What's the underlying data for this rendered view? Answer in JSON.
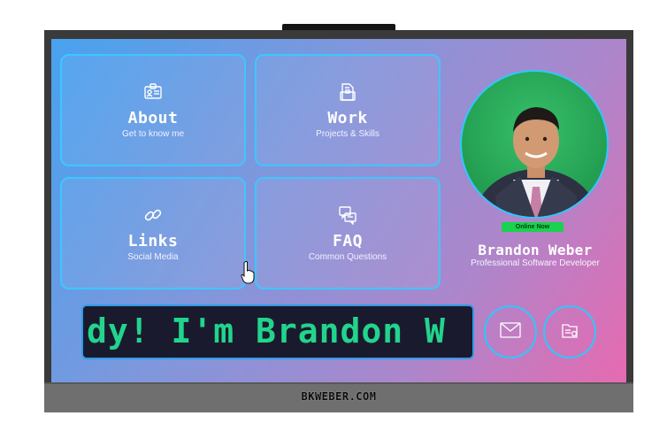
{
  "tiles": [
    {
      "title": "About",
      "subtitle": "Get to know me",
      "icon": "id-card-icon"
    },
    {
      "title": "Work",
      "subtitle": "Projects & Skills",
      "icon": "briefcase-icon"
    },
    {
      "title": "Links",
      "subtitle": "Social Media",
      "icon": "chain-link-icon"
    },
    {
      "title": "FAQ",
      "subtitle": "Common Questions",
      "icon": "chat-bubbles-icon"
    }
  ],
  "profile": {
    "name": "Brandon Weber",
    "role": "Professional Software Developer",
    "status_badge": "Online Now"
  },
  "marquee": {
    "text": "dy! I'm Brandon W"
  },
  "actions": {
    "email_icon": "envelope-icon",
    "resume_icon": "document-folder-icon"
  },
  "footer": {
    "brand": "BKWEBER.COM"
  },
  "colors": {
    "tile_border": "#3ec7ff",
    "marquee_bg": "#1a1a2e",
    "marquee_text": "#22d48c",
    "badge": "#19d24f"
  }
}
